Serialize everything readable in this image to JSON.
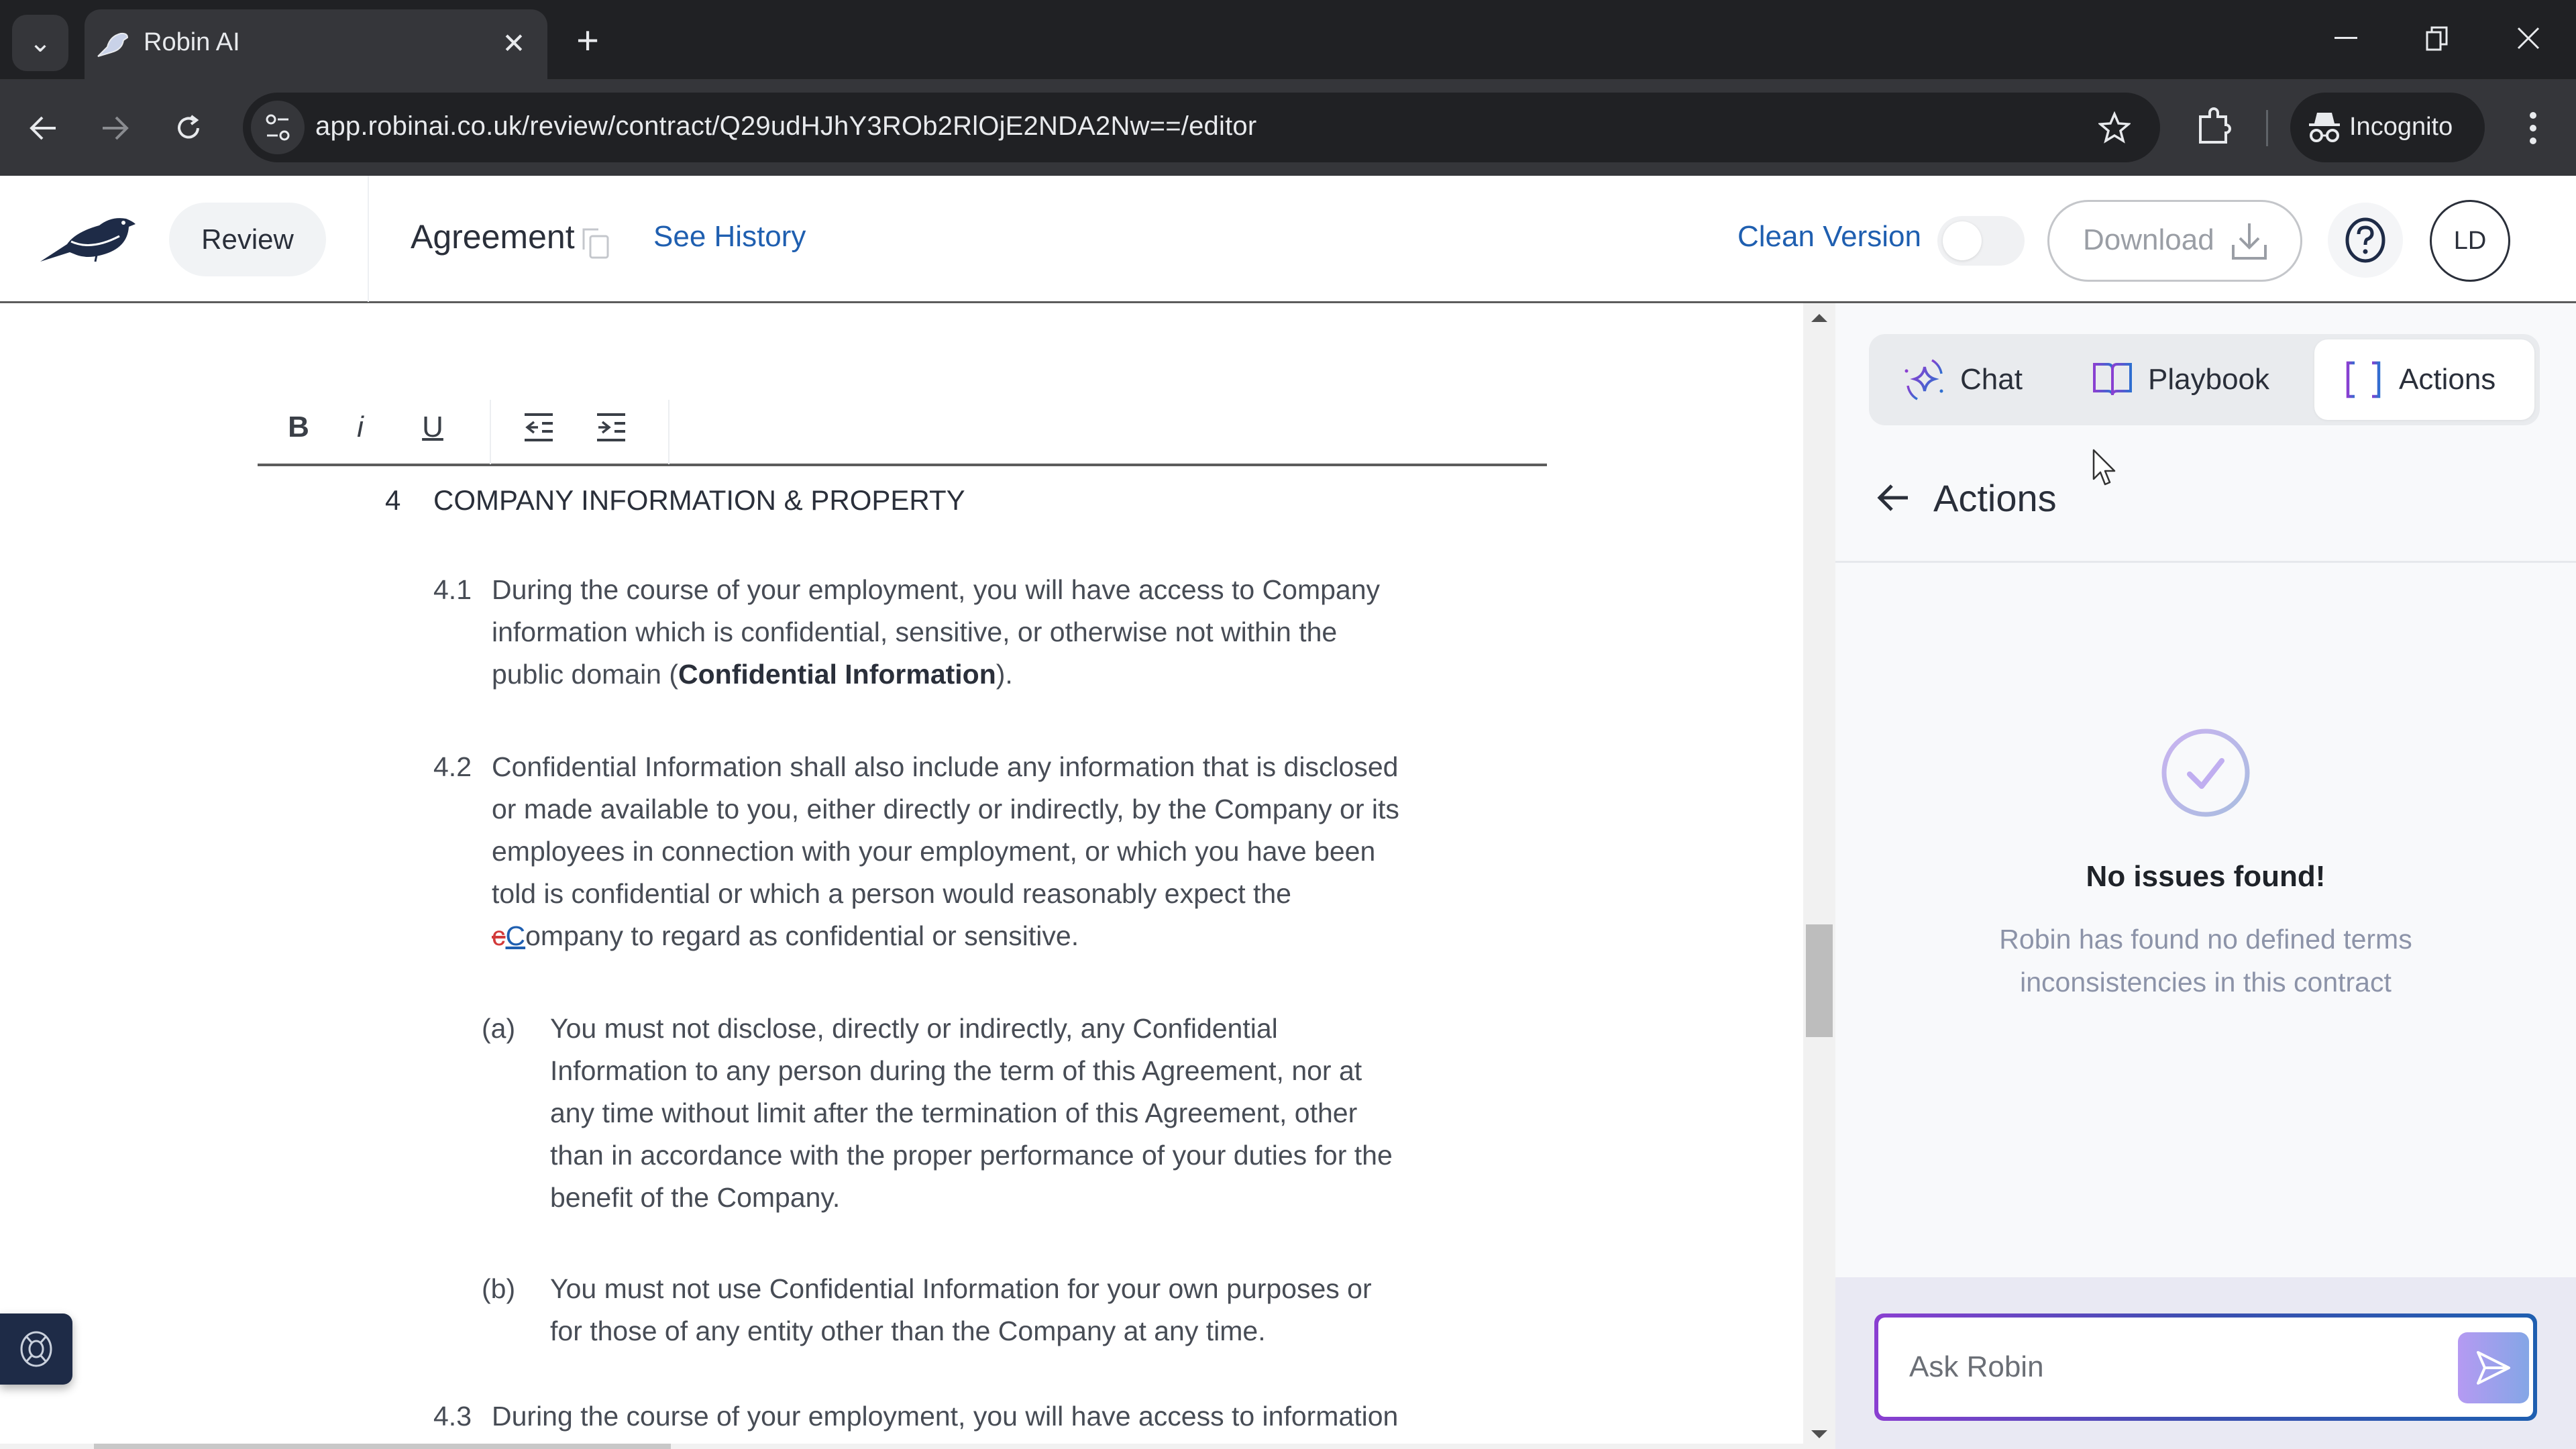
{
  "browser": {
    "tab_title": "Robin AI",
    "url": "app.robinai.co.uk/review/contract/Q29udHJhY3ROb2RlOjE2NDA2Nw==/editor",
    "incognito_label": "Incognito",
    "icons": {
      "tab_search": "chevron-down-icon",
      "tab_close": "close-icon",
      "new_tab": "plus-icon",
      "back": "arrow-left-icon",
      "forward": "arrow-right-icon",
      "reload": "reload-icon",
      "site_info": "tune-icon",
      "bookmark": "star-icon",
      "extensions": "puzzle-icon",
      "incognito": "incognito-icon",
      "menu": "kebab-icon",
      "minimize": "minimize-icon",
      "restore": "restore-icon",
      "close_window": "close-icon"
    },
    "glyphs": {
      "tab_search": "⌄",
      "tab_close": "✕",
      "new_tab": "+",
      "back": "←",
      "forward": "→",
      "reload": "↻",
      "bookmark": "☆",
      "minimize": "—",
      "restore": "❐",
      "close_window": "✕"
    }
  },
  "header": {
    "review_label": "Review",
    "doc_title": "Agreement",
    "see_history": "See History",
    "clean_version_label": "Clean Version",
    "clean_version_on": false,
    "download_label": "Download",
    "avatar_initials": "LD"
  },
  "editor": {
    "toolbar": {
      "bold": "B",
      "italic": "i",
      "underline": "U"
    },
    "section": {
      "number": "4",
      "title": "COMPANY INFORMATION & PROPERTY"
    },
    "clauses": {
      "c41": {
        "number": "4.1",
        "lines": [
          "During the course of your employment, you will have access to Company",
          "information which is confidential, sensitive, or otherwise not within the"
        ],
        "line3_pre": "public domain (",
        "line3_bold": "Confidential Information",
        "line3_post": ")."
      },
      "c42": {
        "number": "4.2",
        "lines": [
          "Confidential Information shall also include any information that is disclosed",
          "or made available to you, either directly or indirectly, by the Company or its",
          "employees in connection with your employment, or which you have been",
          "told is confidential or which a person would reasonably expect the"
        ],
        "line5_deleted": "c",
        "line5_inserted": "C",
        "line5_rest": "ompany to regard as confidential or sensitive."
      },
      "ca": {
        "label": "(a)",
        "lines": [
          "You must not disclose, directly or indirectly, any Confidential",
          "Information to any person during the term of this Agreement, nor at",
          "any time without limit after the termination of this Agreement, other",
          "than in accordance with the proper performance of your duties for the",
          "benefit of the Company."
        ]
      },
      "cb": {
        "label": "(b)",
        "lines": [
          "You must not use Confidential Information for your own purposes or",
          "for those of any entity other than the Company at any time."
        ]
      },
      "c43": {
        "number": "4.3",
        "lines": [
          "During the course of your employment, you will have access to information"
        ]
      }
    }
  },
  "panel": {
    "tabs": [
      {
        "label": "Chat",
        "icon": "sparkle-icon",
        "active": false
      },
      {
        "label": "Playbook",
        "icon": "book-icon",
        "active": false
      },
      {
        "label": "Actions",
        "icon": "brackets-icon",
        "active": true
      }
    ],
    "section_title": "Actions",
    "empty_state": {
      "title": "No issues found!",
      "description_lines": [
        "Robin has found no defined terms",
        "inconsistencies in this contract"
      ]
    },
    "ask": {
      "placeholder": "Ask Robin"
    }
  },
  "colors": {
    "link_blue": "#1f5fb0",
    "brand_navy": "#1e2b47",
    "accent_purple": "#8a3fd1",
    "deleted_red": "#d23a3a"
  }
}
